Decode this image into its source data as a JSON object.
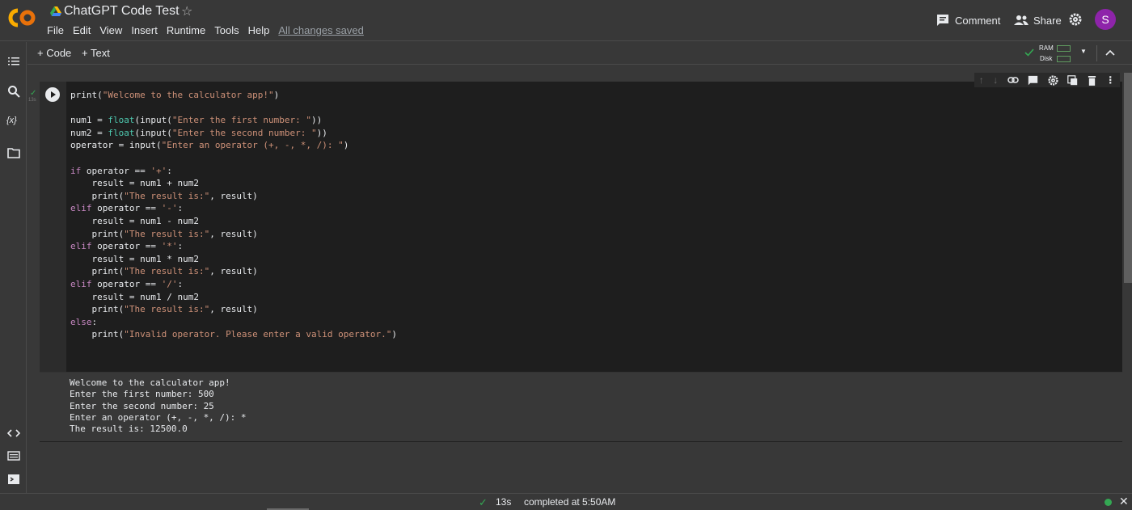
{
  "header": {
    "title": "ChatGPT Code Test",
    "menu": [
      "File",
      "Edit",
      "View",
      "Insert",
      "Runtime",
      "Tools",
      "Help"
    ],
    "saved_status": "All changes saved",
    "comment_label": "Comment",
    "share_label": "Share",
    "avatar_letter": "S",
    "accent_color": "#8e24aa"
  },
  "toolbar": {
    "add_code_label": "+ Code",
    "add_text_label": "+ Text",
    "ram_label": "RAM",
    "disk_label": "Disk"
  },
  "cell": {
    "exec_time_small": "13s",
    "code_lines": [
      "print(\"Welcome to the calculator app!\")",
      "",
      "num1 = float(input(\"Enter the first number: \"))",
      "num2 = float(input(\"Enter the second number: \"))",
      "operator = input(\"Enter an operator (+, -, *, /): \")",
      "",
      "if operator == '+':",
      "    result = num1 + num2",
      "    print(\"The result is:\", result)",
      "elif operator == '-':",
      "    result = num1 - num2",
      "    print(\"The result is:\", result)",
      "elif operator == '*':",
      "    result = num1 * num2",
      "    print(\"The result is:\", result)",
      "elif operator == '/':",
      "    result = num1 / num2",
      "    print(\"The result is:\", result)",
      "else:",
      "    print(\"Invalid operator. Please enter a valid operator.\")"
    ],
    "output_lines": [
      "Welcome to the calculator app!",
      "Enter the first number: 500",
      "Enter the second number: 25",
      "Enter an operator (+, -, *, /): *",
      "The result is: 12500.0"
    ]
  },
  "status": {
    "time": "13s",
    "completed": "completed at 5:50AM"
  }
}
